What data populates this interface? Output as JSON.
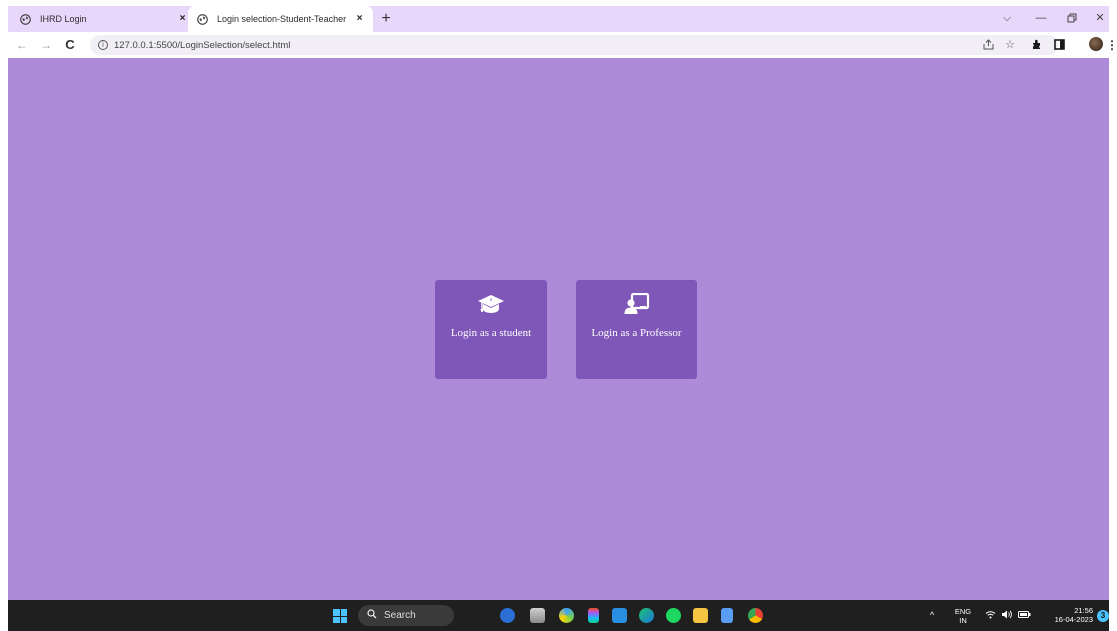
{
  "browser": {
    "tabs": [
      {
        "title": "IHRD Login",
        "active": false
      },
      {
        "title": "Login selection-Student-Teacher",
        "active": true
      }
    ],
    "new_tab_label": "+",
    "close_label": "×",
    "url": "127.0.0.1:5500/LoginSelection/select.html"
  },
  "page": {
    "background_color": "#ae8bd8",
    "card_color": "#7e57b8",
    "options": [
      {
        "label": "Login as a student",
        "icon": "graduation-cap-icon"
      },
      {
        "label": "Login as a Professor",
        "icon": "chalkboard-teacher-icon"
      }
    ]
  },
  "taskbar": {
    "search_label": "Search",
    "language_top": "ENG",
    "language_bottom": "IN",
    "time": "21:56",
    "date": "16-04-2023",
    "notification_count": "3"
  }
}
